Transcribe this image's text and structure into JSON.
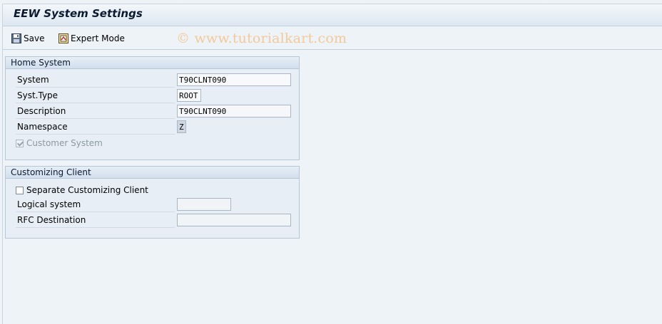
{
  "window": {
    "title": "EEW System Settings"
  },
  "toolbar": {
    "save_label": "Save",
    "expert_mode_label": "Expert Mode",
    "watermark": "© www.tutorialkart.com",
    "save_icon": "floppy-disk-icon",
    "expert_mode_icon": "expert-mode-icon"
  },
  "home_system": {
    "header": "Home System",
    "system_label": "System",
    "system_value": "T90CLNT090",
    "syst_type_label": "Syst.Type",
    "syst_type_value": "ROOT",
    "description_label": "Description",
    "description_value": "T90CLNT090",
    "namespace_label": "Namespace",
    "namespace_value": "Z",
    "customer_system_label": "Customer System",
    "customer_system_checked": true
  },
  "customizing_client": {
    "header": "Customizing Client",
    "separate_label": "Separate Customizing Client",
    "separate_checked": false,
    "logical_system_label": "Logical system",
    "logical_system_value": "",
    "rfc_destination_label": "RFC Destination",
    "rfc_destination_value": ""
  },
  "colors": {
    "background": "#eef3f8",
    "group_header": "#d2dfec",
    "watermark": "#f2c99a"
  }
}
